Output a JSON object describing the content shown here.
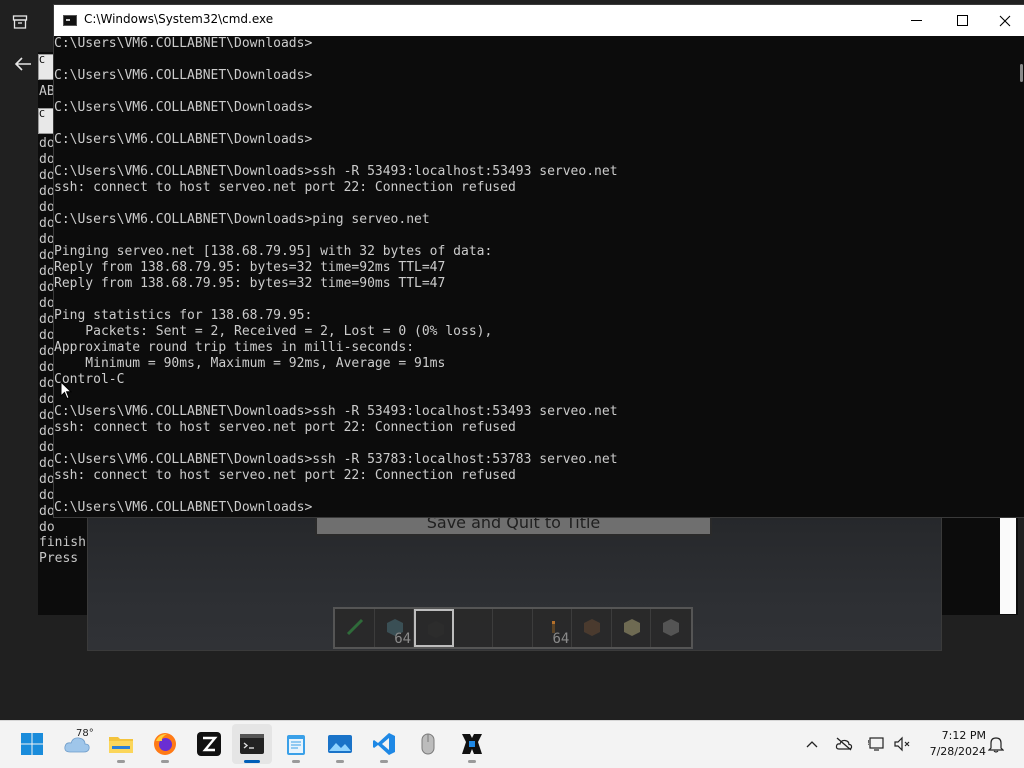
{
  "background_app": {
    "tab_labels": [
      "C",
      "C"
    ],
    "left_text": "AB",
    "lines": [
      "do",
      "do",
      "do",
      "do",
      "do",
      "do",
      "do",
      "do",
      "do",
      "do",
      "do",
      "do",
      "do",
      "do",
      "do",
      "do",
      "do",
      "do",
      "do",
      "do",
      "do",
      "do",
      "do",
      "do",
      "do"
    ],
    "bottom_lines": [
      "finish",
      "Press"
    ]
  },
  "game": {
    "menu_button": "Save and Quit to Title",
    "hotbar_counts": [
      "",
      "64",
      "",
      "",
      "",
      "64",
      "",
      "",
      ""
    ]
  },
  "cmd": {
    "title": "C:\\Windows\\System32\\cmd.exe",
    "lines": [
      "C:\\Users\\VM6.COLLABNET\\Downloads>",
      "",
      "C:\\Users\\VM6.COLLABNET\\Downloads>",
      "",
      "C:\\Users\\VM6.COLLABNET\\Downloads>",
      "",
      "C:\\Users\\VM6.COLLABNET\\Downloads>",
      "",
      "C:\\Users\\VM6.COLLABNET\\Downloads>ssh -R 53493:localhost:53493 serveo.net",
      "ssh: connect to host serveo.net port 22: Connection refused",
      "",
      "C:\\Users\\VM6.COLLABNET\\Downloads>ping serveo.net",
      "",
      "Pinging serveo.net [138.68.79.95] with 32 bytes of data:",
      "Reply from 138.68.79.95: bytes=32 time=92ms TTL=47",
      "Reply from 138.68.79.95: bytes=32 time=90ms TTL=47",
      "",
      "Ping statistics for 138.68.79.95:",
      "    Packets: Sent = 2, Received = 2, Lost = 0 (0% loss),",
      "Approximate round trip times in milli-seconds:",
      "    Minimum = 90ms, Maximum = 92ms, Average = 91ms",
      "Control-C",
      "",
      "C:\\Users\\VM6.COLLABNET\\Downloads>ssh -R 53493:localhost:53493 serveo.net",
      "ssh: connect to host serveo.net port 22: Connection refused",
      "",
      "C:\\Users\\VM6.COLLABNET\\Downloads>ssh -R 53783:localhost:53783 serveo.net",
      "ssh: connect to host serveo.net port 22: Connection refused",
      "",
      "C:\\Users\\VM6.COLLABNET\\Downloads>"
    ]
  },
  "taskbar": {
    "weather_temp": "78°",
    "time": "7:12 PM",
    "date": "7/28/2024",
    "apps": [
      "start-icon",
      "weather-icon",
      "file-explorer-icon",
      "firefox-icon",
      "zed-icon",
      "terminal-icon",
      "notepad-icon",
      "photos-icon",
      "vscode-icon",
      "mouse-icon",
      "minecraft-icon"
    ],
    "accent": "#005fb8"
  }
}
